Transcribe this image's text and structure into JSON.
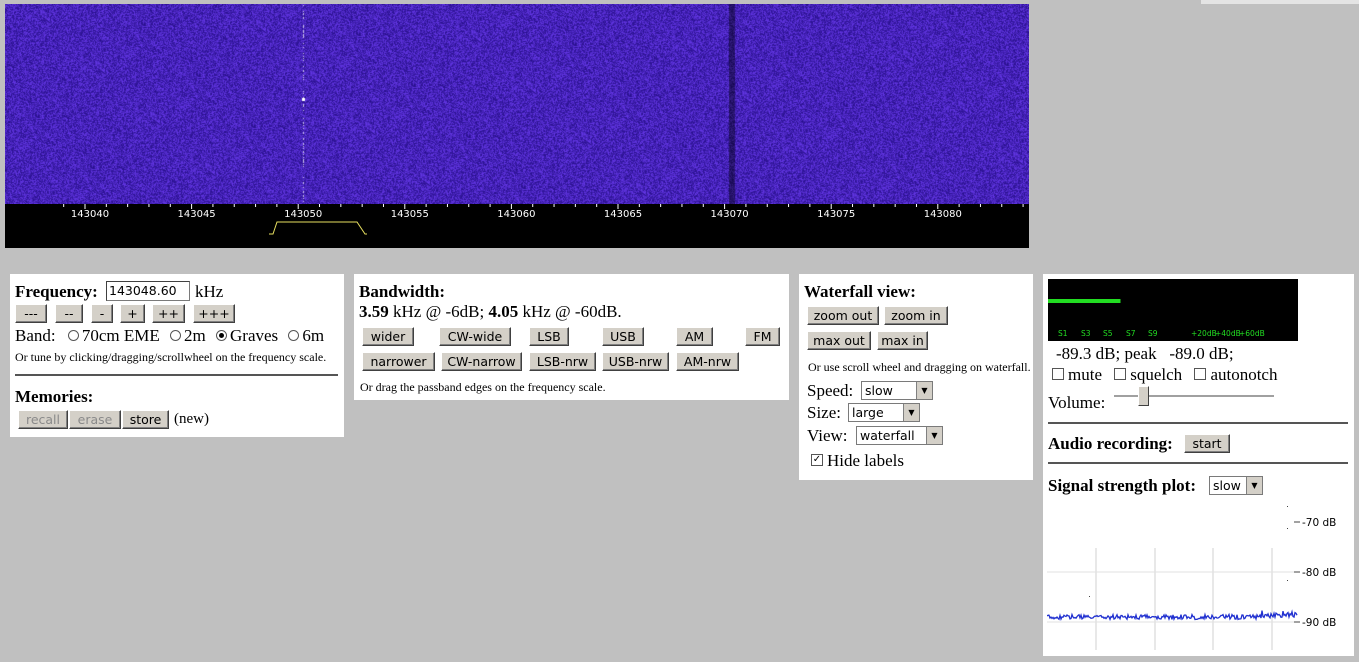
{
  "waterfall": {
    "ticks": [
      "143040",
      "143045",
      "143050",
      "143055",
      "143060",
      "143065",
      "143070",
      "143075",
      "143080"
    ],
    "colors": {
      "background": "#3a1fa3",
      "passband": "#e8e060",
      "ticks": "#ffffff"
    }
  },
  "frequency": {
    "label": "Frequency:",
    "value": "143048.60",
    "unit": "kHz",
    "step_buttons": [
      "---",
      "--",
      "-",
      "+",
      "++",
      "+++"
    ],
    "band_label": "Band:",
    "bands": [
      {
        "label": "70cm EME",
        "selected": false
      },
      {
        "label": "2m",
        "selected": false
      },
      {
        "label": "Graves",
        "selected": true
      },
      {
        "label": "6m",
        "selected": false
      }
    ],
    "hint": "Or tune by clicking/dragging/scrollwheel on the frequency scale."
  },
  "memories": {
    "title": "Memories:",
    "recall": "recall",
    "erase": "erase",
    "store": "store",
    "status": "(new)"
  },
  "bandwidth": {
    "title": "Bandwidth:",
    "bw6": "3.59",
    "bw6_text": " kHz @ -6dB; ",
    "bw60": "4.05",
    "bw60_text": " kHz @ -60dB.",
    "row1": [
      "wider",
      "CW-wide",
      "LSB",
      "USB",
      "AM",
      "FM"
    ],
    "row2": [
      "narrower",
      "CW-narrow",
      "LSB-nrw",
      "USB-nrw",
      "AM-nrw"
    ],
    "hint": "Or drag the passband edges on the frequency scale."
  },
  "waterfall_view": {
    "title": "Waterfall view:",
    "zoom_out": "zoom out",
    "zoom_in": "zoom in",
    "max_out": "max out",
    "max_in": "max in",
    "hint": "Or use scroll wheel and dragging on waterfall.",
    "speed_label": "Speed:",
    "speed_value": "slow",
    "size_label": "Size:",
    "size_value": "large",
    "view_label": "View:",
    "view_value": "waterfall",
    "hide_labels": "Hide labels",
    "hide_labels_checked": true
  },
  "smeter": {
    "scale": [
      "S1",
      "S3",
      "S5",
      "S7",
      "S9",
      "+20dB",
      "+40dB",
      "+60dB"
    ],
    "level_fraction": 0.29,
    "color": "#22dd22",
    "readout": "-89.3 dB; peak   -89.0 dB;"
  },
  "audio": {
    "mute": "mute",
    "squelch": "squelch",
    "autonotch": "autonotch",
    "volume_label": "Volume:",
    "volume_fraction": 0.18,
    "recording_label": "Audio recording:",
    "start": "start"
  },
  "signal_plot": {
    "label": "Signal strength plot:",
    "speed_value": "slow",
    "axis": [
      "-70 dB",
      "-80 dB",
      "-90 dB"
    ],
    "trace_color": "#2030d0"
  }
}
